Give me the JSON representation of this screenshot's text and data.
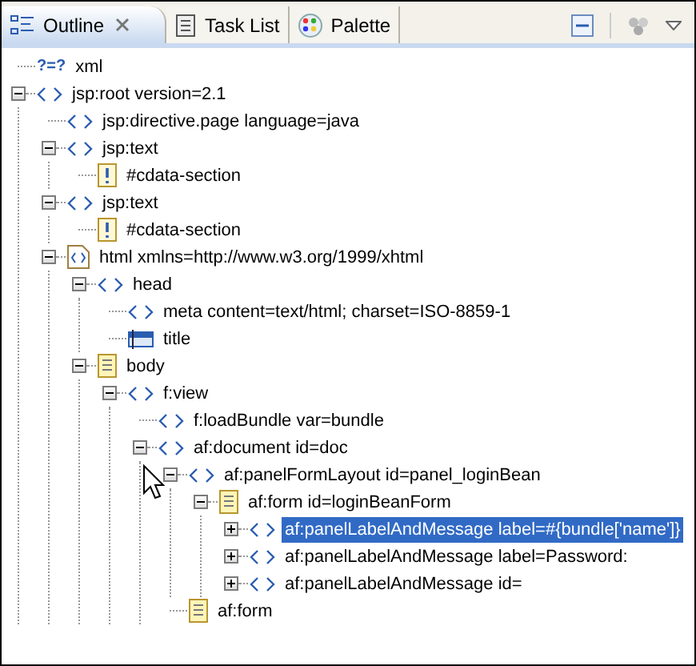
{
  "tabs": [
    {
      "label": "Outline",
      "selected": true,
      "closable": true,
      "kind": "outline"
    },
    {
      "label": "Task List",
      "selected": false,
      "closable": false,
      "kind": "tasks"
    },
    {
      "label": "Palette",
      "selected": false,
      "closable": false,
      "kind": "palette"
    }
  ],
  "tree": [
    {
      "label": "xml",
      "kind": "pi",
      "marker": "?=?",
      "selected": false
    },
    {
      "label": "jsp:root version=2.1",
      "kind": "tag",
      "expanded": true,
      "selected": false,
      "children": [
        {
          "label": "jsp:directive.page language=java",
          "kind": "tag",
          "selected": false
        },
        {
          "label": "jsp:text",
          "kind": "tag",
          "expanded": true,
          "selected": false,
          "children": [
            {
              "label": "#cdata-section",
              "kind": "cdata",
              "selected": false
            }
          ]
        },
        {
          "label": "jsp:text",
          "kind": "tag",
          "expanded": true,
          "selected": false,
          "children": [
            {
              "label": "#cdata-section",
              "kind": "cdata",
              "selected": false
            }
          ]
        },
        {
          "label": "html xmlns=http://www.w3.org/1999/xhtml",
          "kind": "html",
          "expanded": true,
          "selected": false,
          "children": [
            {
              "label": "head",
              "kind": "tag",
              "expanded": true,
              "selected": false,
              "children": [
                {
                  "label": "meta content=text/html; charset=ISO-8859-1",
                  "kind": "tag",
                  "selected": false
                },
                {
                  "label": "title",
                  "kind": "title",
                  "selected": false
                }
              ]
            },
            {
              "label": "body",
              "kind": "doc",
              "expanded": true,
              "selected": false,
              "children": [
                {
                  "label": "f:view",
                  "kind": "tag",
                  "expanded": true,
                  "selected": false,
                  "children": [
                    {
                      "label": "f:loadBundle var=bundle",
                      "kind": "tag",
                      "selected": false
                    },
                    {
                      "label": "af:document id=doc",
                      "kind": "tag",
                      "expanded": true,
                      "selected": false,
                      "children": [
                        {
                          "label": "af:panelFormLayout id=panel_loginBean",
                          "kind": "tag",
                          "expanded": true,
                          "selected": false,
                          "children": [
                            {
                              "label": "af:form id=loginBeanForm",
                              "kind": "doc",
                              "expanded": true,
                              "selected": false,
                              "children": [
                                {
                                  "label": "af:panelLabelAndMessage label=#{bundle['name']}",
                                  "kind": "tag",
                                  "expanded": false,
                                  "selected": true
                                },
                                {
                                  "label": "af:panelLabelAndMessage label=Password:",
                                  "kind": "tag",
                                  "expanded": false,
                                  "selected": false
                                },
                                {
                                  "label": "af:panelLabelAndMessage id=",
                                  "kind": "tag",
                                  "expanded": false,
                                  "selected": false
                                }
                              ]
                            }
                          ]
                        },
                        {
                          "label": "af:form",
                          "kind": "doc",
                          "selected": false
                        }
                      ]
                    }
                  ]
                }
              ]
            }
          ]
        }
      ]
    }
  ]
}
